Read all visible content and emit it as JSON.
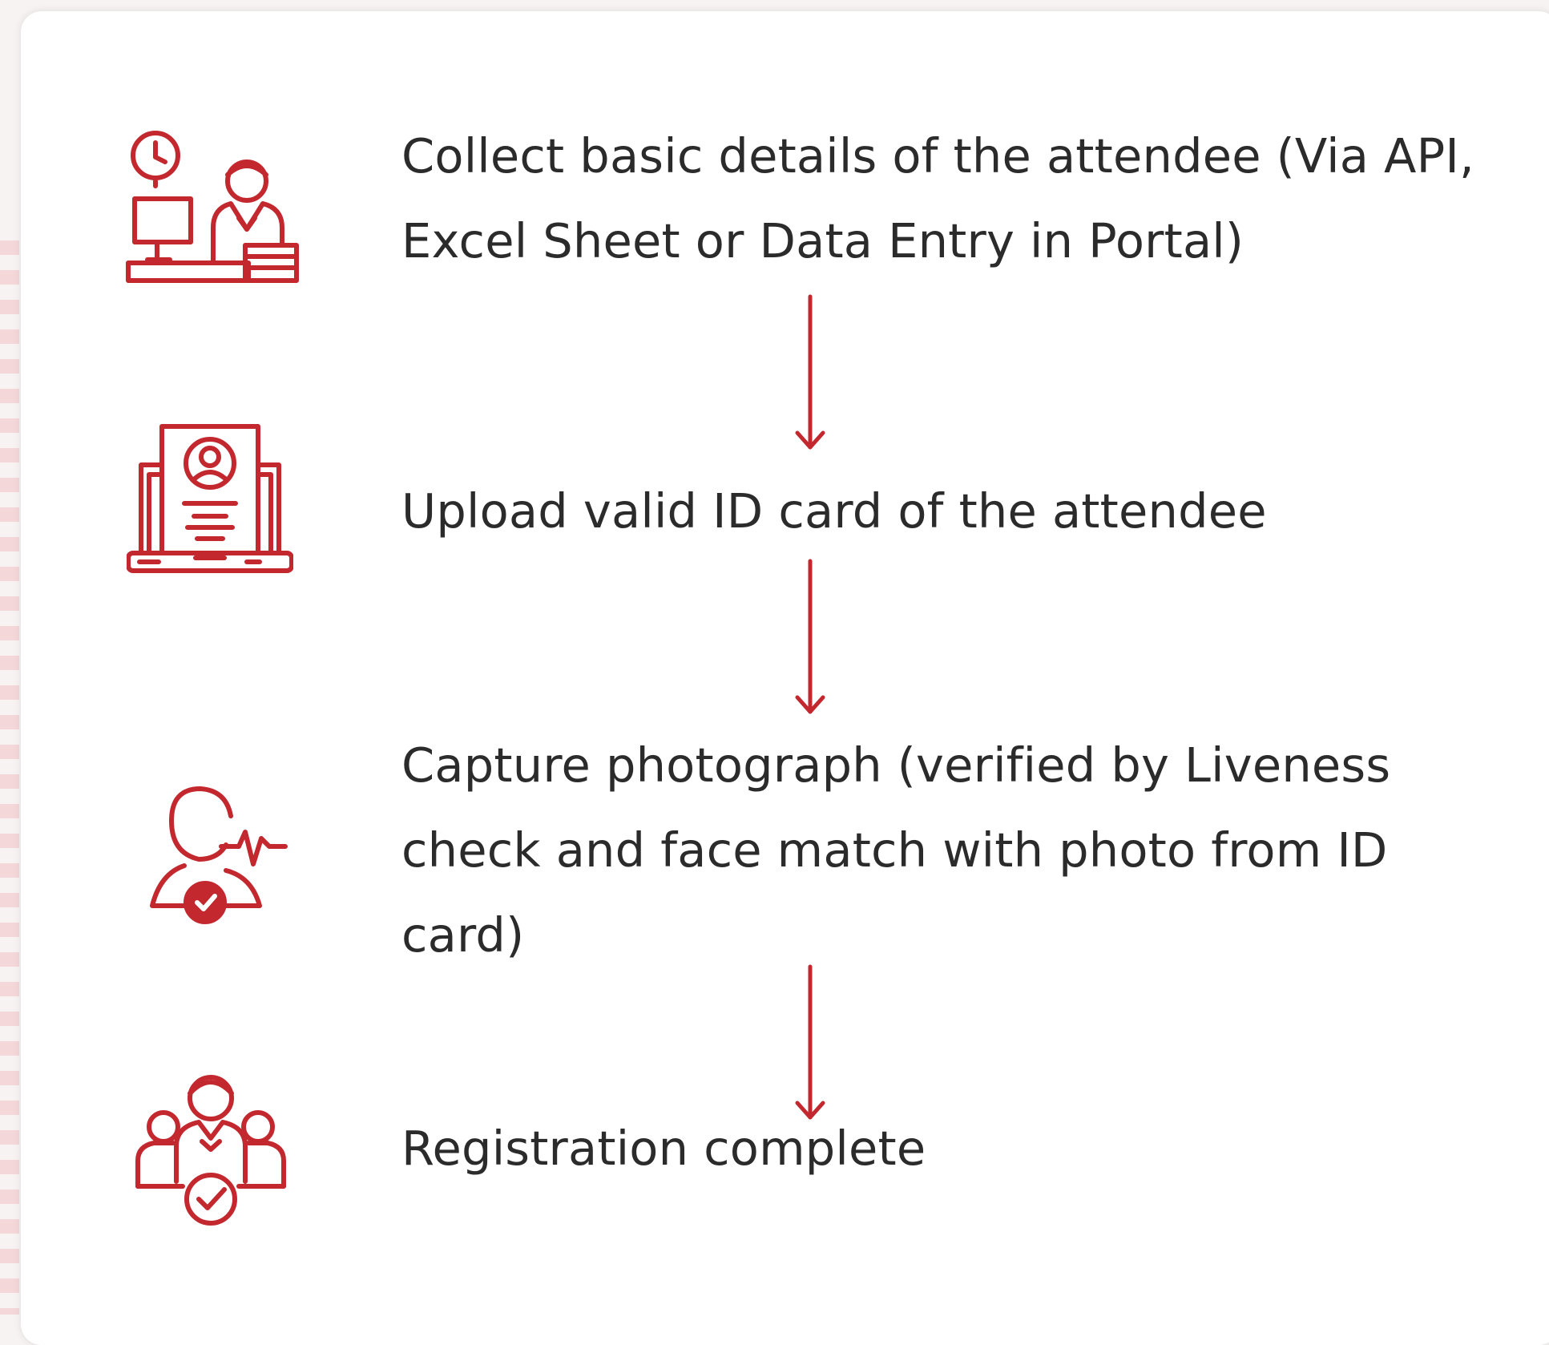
{
  "theme": {
    "accent_color": "#c3282f",
    "text_color": "#2b2b2b"
  },
  "steps": [
    {
      "icon": "desk-clerk-icon",
      "text": "Collect basic details of the attendee (Via API, Excel Sheet or Data Entry in Portal)"
    },
    {
      "icon": "id-card-laptop-icon",
      "text": "Upload valid ID card of the attendee"
    },
    {
      "icon": "face-liveness-check-icon",
      "text": "Capture photograph (verified by Liveness check and face match with photo from ID card)"
    },
    {
      "icon": "group-verified-icon",
      "text": "Registration complete"
    }
  ]
}
